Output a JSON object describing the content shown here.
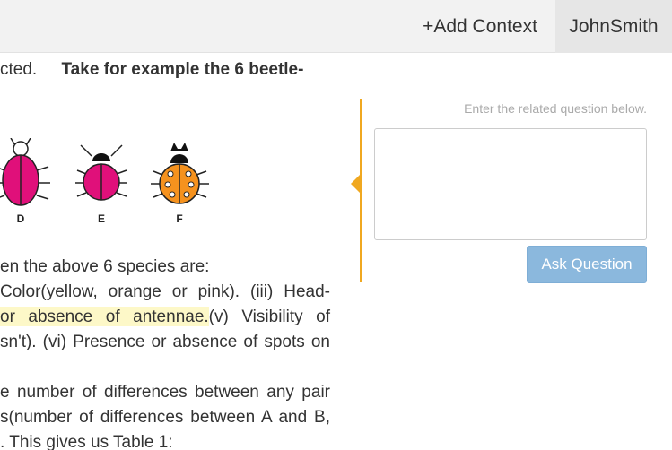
{
  "header": {
    "add_context_label": "+Add Context",
    "user_name": "JohnSmith"
  },
  "document": {
    "line_1_part_a": "cted.",
    "line_1_part_b": "Take for example the 6 beetle-",
    "figure_labels": [
      "D",
      "E",
      "F"
    ],
    "line_2": "en the above 6 species are:",
    "line_3": "Color(yellow, orange or pink). (iii) Head-",
    "line_4_highlight": "or absence of antennae.",
    "line_4_rest": "(v) Visibility of",
    "line_5": "sn't). (vi) Presence or absence of spots on",
    "line_6": "e number of differences between any pair",
    "line_7": "s(number of differences between A and B,",
    "line_8": ". This gives us Table 1:"
  },
  "question_panel": {
    "hint": "Enter the related question below.",
    "input_value": "",
    "ask_button_label": "Ask Question"
  },
  "colors": {
    "accent_orange": "#f0a820",
    "button_blue": "#8bb8dd",
    "beetle_pink": "#e0107a",
    "beetle_orange": "#f5921e",
    "highlight": "#fdf8c8"
  }
}
